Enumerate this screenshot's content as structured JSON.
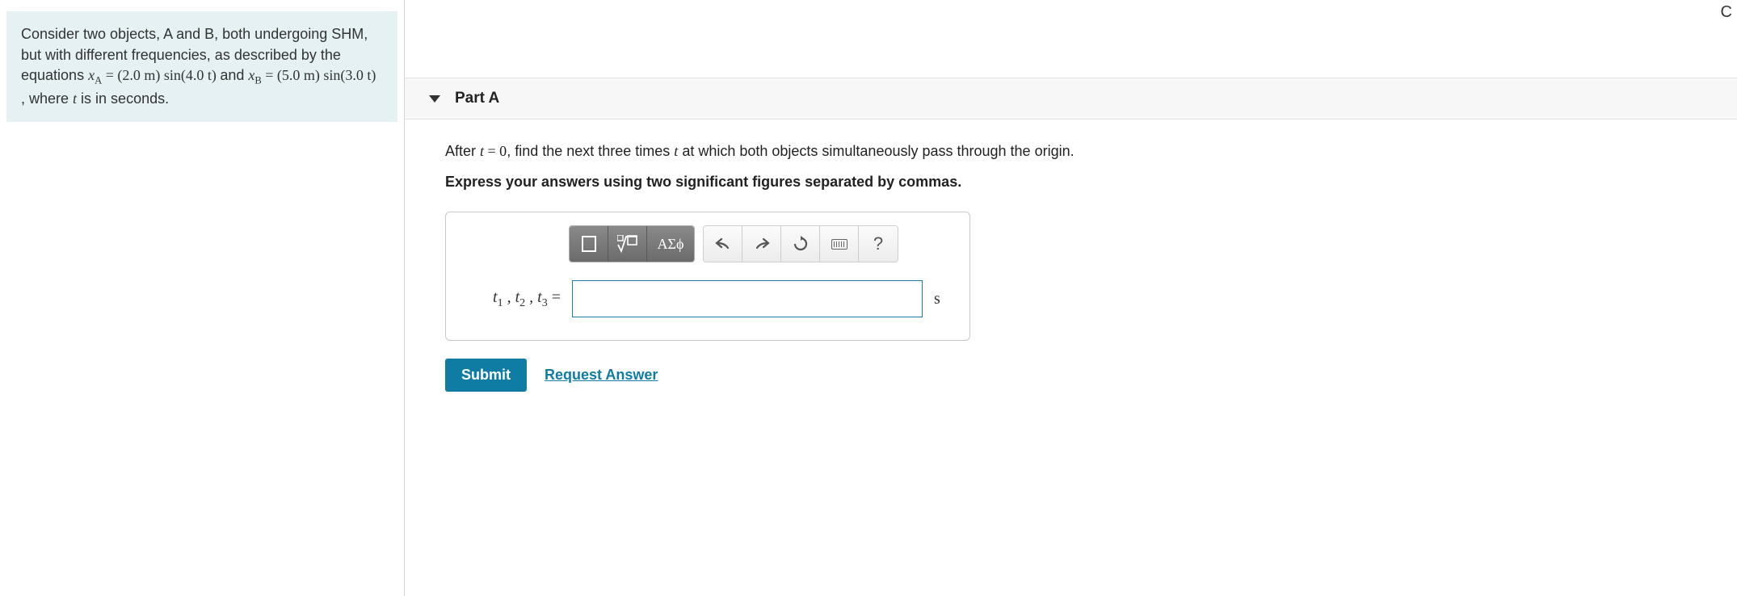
{
  "problem": {
    "intro1": "Consider two objects, A and B, both undergoing SHM, but with different frequencies, as described by the equations ",
    "eqA_lhs": "x",
    "eqA_sub": "A",
    "eqA_rhs": " = (2.0 m) sin(4.0 t)",
    "mid": " and ",
    "eqB_lhs": "x",
    "eqB_sub": "B",
    "eqB_rhs": " = (5.0 m) sin(3.0 t)",
    "tail": ", where ",
    "t_var": "t",
    "tail2": " is in seconds."
  },
  "part": {
    "label": "Part A",
    "question_pre": "After ",
    "q_t": "t",
    "q_eq": " = 0",
    "question_post": ", find the next three times ",
    "q_t2": "t",
    "question_end": " at which both objects simultaneously pass through the origin.",
    "instruction": "Express your answers using two significant figures separated by commas."
  },
  "toolbar": {
    "templates_tip": "templates",
    "sqrt_tip": "radical/fraction",
    "greek_label": "ΑΣϕ",
    "undo_tip": "undo",
    "redo_tip": "redo",
    "reset_tip": "reset",
    "keyboard_tip": "keyboard",
    "help_label": "?"
  },
  "answer": {
    "label_t1": "t",
    "label_s1": "1",
    "label_t2": "t",
    "label_s2": "2",
    "label_t3": "t",
    "label_s3": "3",
    "eq": " = ",
    "value": "",
    "unit": "s"
  },
  "actions": {
    "submit": "Submit",
    "request": "Request Answer"
  },
  "corner": "C"
}
